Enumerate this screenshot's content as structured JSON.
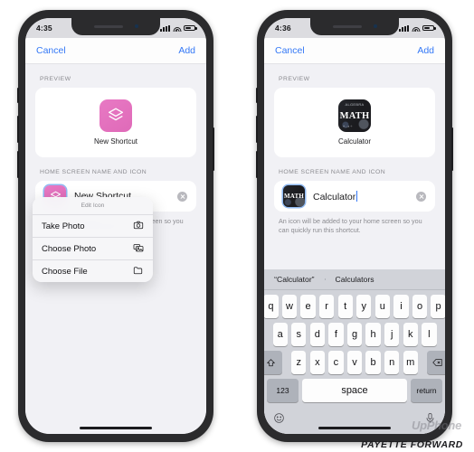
{
  "phones": {
    "left": {
      "status": {
        "time": "4:35",
        "signal_icon": "cellular-bars-icon",
        "wifi_icon": "wifi-icon",
        "battery_icon": "battery-icon"
      },
      "navbar": {
        "cancel": "Cancel",
        "add": "Add"
      },
      "preview_label": "PREVIEW",
      "preview": {
        "icon_name": "shortcuts-stack-icon",
        "name": "New Shortcut"
      },
      "home_section_label": "HOME SCREEN NAME AND ICON",
      "field": {
        "value": "New Shortcut",
        "icon_name": "shortcuts-stack-icon",
        "clear_label": ""
      },
      "hint": "An icon will be added to your home screen so you can quickly run this shortcut.",
      "context_menu": {
        "title": "Edit Icon",
        "items": [
          {
            "label": "Take Photo",
            "icon": "camera-icon"
          },
          {
            "label": "Choose Photo",
            "icon": "photos-icon"
          },
          {
            "label": "Choose File",
            "icon": "folder-icon"
          }
        ]
      }
    },
    "right": {
      "status": {
        "time": "4:36",
        "signal_icon": "cellular-bars-icon",
        "wifi_icon": "wifi-icon",
        "battery_icon": "battery-icon"
      },
      "navbar": {
        "cancel": "Cancel",
        "add": "Add"
      },
      "preview_label": "PREVIEW",
      "preview": {
        "icon_name": "math-app-icon",
        "icon_text": "MATH",
        "icon_top_text": "ALGEBRA",
        "icon_sub_text": "+ - × ÷",
        "name": "Calculator"
      },
      "home_section_label": "HOME SCREEN NAME AND ICON",
      "field": {
        "value": "Calculator",
        "icon_name": "math-app-icon",
        "icon_text": "MATH"
      },
      "hint": "An icon will be added to your home screen so you can quickly run this shortcut.",
      "keyboard": {
        "predictions": [
          "“Calculator”",
          "Calculators"
        ],
        "row1": [
          "q",
          "w",
          "e",
          "r",
          "t",
          "y",
          "u",
          "i",
          "o",
          "p"
        ],
        "row2": [
          "a",
          "s",
          "d",
          "f",
          "g",
          "h",
          "j",
          "k",
          "l"
        ],
        "row3": [
          "z",
          "x",
          "c",
          "v",
          "b",
          "n",
          "m"
        ],
        "shift_icon": "shift-icon",
        "delete_icon": "delete-icon",
        "numbers_key": "123",
        "space_key": "space",
        "return_key": "return",
        "emoji_icon": "emoji-icon",
        "dictation_icon": "microphone-icon"
      }
    }
  },
  "watermarks": {
    "brand": "UpPhone",
    "publisher": "PAYETTE FORWARD"
  },
  "colors": {
    "accent_blue": "#3478f6",
    "shortcut_pink": "#df6ab8",
    "bg_grey": "#f1f1f5"
  }
}
